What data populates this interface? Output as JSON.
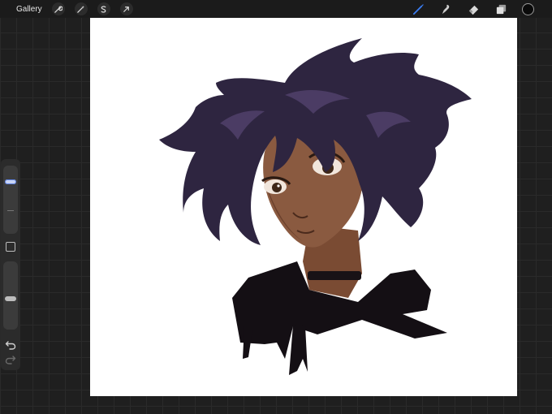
{
  "topbar": {
    "gallery_label": "Gallery",
    "left_icons": [
      "wrench-icon",
      "magic-wand-icon",
      "selection-s-icon",
      "move-arrow-icon"
    ],
    "right_icons": [
      "brush-icon",
      "smudge-icon",
      "eraser-icon",
      "layers-icon"
    ],
    "active_tool": "brush",
    "active_tool_color": "#3a7cf0",
    "current_color": "#0a0a0a"
  },
  "sidebar": {
    "brush_size_level": 0.78,
    "opacity_level": 0.45
  },
  "artwork": {
    "hair_color": "#2e2540",
    "hair_highlight": "#4b3c64",
    "skin_color": "#8a5a40",
    "skin_shadow": "#6b402c",
    "clothing_color": "#140f14"
  }
}
